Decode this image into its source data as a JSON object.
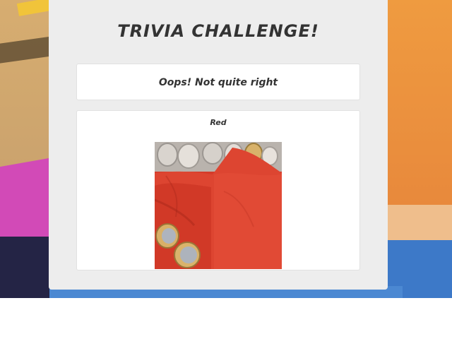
{
  "title": "TRIVIA CHALLENGE!",
  "result": {
    "message": "Oops! Not quite right"
  },
  "answer": {
    "label": "Red",
    "image_icon": "red-powder-image"
  },
  "colors": {
    "card_background": "#ededed",
    "box_background": "#ffffff",
    "text": "#333333",
    "powder": "#d53b2a",
    "background_orange": "#e8893c",
    "background_blue": "#3d79c8"
  }
}
